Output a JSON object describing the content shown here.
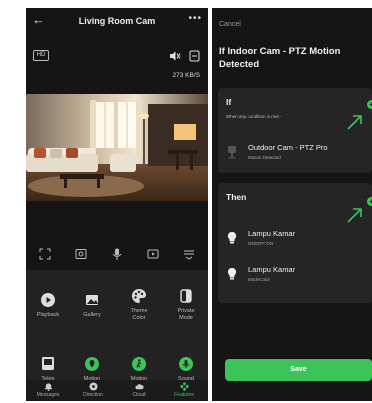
{
  "left": {
    "title": "Living Room Cam",
    "hd_label": "HD",
    "bitrate": "273 KB/S",
    "features": [
      {
        "label": "Playback",
        "icon": "play-icon"
      },
      {
        "label": "Gallery",
        "icon": "image-icon"
      },
      {
        "label": "Theme\nColor",
        "icon": "palette-icon"
      },
      {
        "label": "Private\nMode",
        "icon": "privacy-icon"
      },
      {
        "label": "Telep",
        "icon": "tablet-icon"
      },
      {
        "label": "Motion",
        "icon": "location-icon"
      },
      {
        "label": "Motion",
        "icon": "walk-icon"
      },
      {
        "label": "Sound",
        "icon": "mic-icon"
      }
    ],
    "tabs": [
      {
        "label": "Messages",
        "icon": "bell-icon"
      },
      {
        "label": "Direction",
        "icon": "dpad-icon"
      },
      {
        "label": "Cloud",
        "icon": "cloud-icon"
      },
      {
        "label": "Features",
        "icon": "features-icon"
      }
    ]
  },
  "right": {
    "cancel": "Cancel",
    "title": "If Indoor Cam - PTZ Motion Detected",
    "if_card": {
      "heading": "If",
      "subtext": "When any condition is met -",
      "item": {
        "name": "Outdoor Cam - PTZ Pro",
        "state": "Motion Detected"
      }
    },
    "then_card": {
      "heading": "Then",
      "items": [
        {
          "name": "Lampu Kamar",
          "state": "ON/OFF:ON"
        },
        {
          "name": "Lampu Kamar",
          "state": "ModeColor"
        }
      ]
    },
    "save": "Save"
  },
  "colors": {
    "accent": "#3cc45a",
    "panel_bg": "#151515",
    "card_bg": "#252525"
  }
}
